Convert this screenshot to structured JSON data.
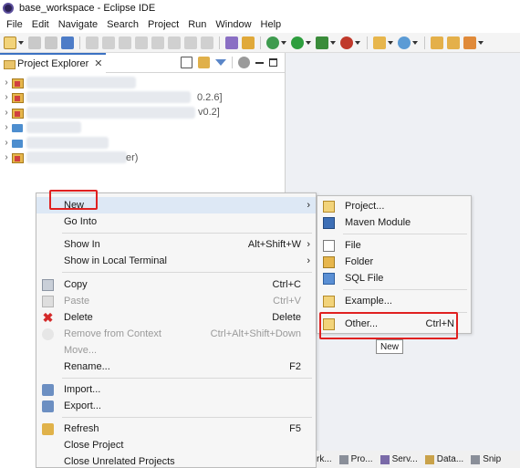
{
  "window": {
    "title": "base_workspace - Eclipse IDE"
  },
  "menubar": [
    "File",
    "Edit",
    "Navigate",
    "Search",
    "Project",
    "Run",
    "Window",
    "Help"
  ],
  "explorer": {
    "tab_label": "Project Explorer",
    "tab_close": "✕",
    "tree": [
      {
        "icon": "project-icon",
        "suffix": ""
      },
      {
        "icon": "project-icon",
        "suffix": "0.2.6]"
      },
      {
        "icon": "project-icon",
        "suffix": "v0.2]"
      },
      {
        "icon": "folder-icon",
        "suffix": ""
      },
      {
        "icon": "folder-icon",
        "suffix": ""
      },
      {
        "icon": "project-icon",
        "suffix": "er)"
      }
    ]
  },
  "context_menu": {
    "items": [
      {
        "label": "New",
        "shortcut": "",
        "arrow": "›",
        "icon": "",
        "enabled": true
      },
      {
        "label": "Go Into",
        "shortcut": "",
        "arrow": "",
        "icon": "",
        "enabled": true
      },
      {
        "label": "Show In",
        "shortcut": "Alt+Shift+W",
        "arrow": "›",
        "icon": "",
        "enabled": true
      },
      {
        "label": "Show in Local Terminal",
        "shortcut": "",
        "arrow": "›",
        "icon": "",
        "enabled": true
      },
      {
        "label": "Copy",
        "shortcut": "Ctrl+C",
        "arrow": "",
        "icon": "copy-icon",
        "enabled": true
      },
      {
        "label": "Paste",
        "shortcut": "Ctrl+V",
        "arrow": "",
        "icon": "paste-icon",
        "enabled": false
      },
      {
        "label": "Delete",
        "shortcut": "Delete",
        "arrow": "",
        "icon": "delete-icon",
        "enabled": true
      },
      {
        "label": "Remove from Context",
        "shortcut": "Ctrl+Alt+Shift+Down",
        "arrow": "",
        "icon": "remove-context-icon",
        "enabled": false
      },
      {
        "label": "Move...",
        "shortcut": "",
        "arrow": "",
        "icon": "",
        "enabled": false
      },
      {
        "label": "Rename...",
        "shortcut": "F2",
        "arrow": "",
        "icon": "",
        "enabled": true
      },
      {
        "label": "Import...",
        "shortcut": "",
        "arrow": "",
        "icon": "import-icon",
        "enabled": true
      },
      {
        "label": "Export...",
        "shortcut": "",
        "arrow": "",
        "icon": "export-icon",
        "enabled": true
      },
      {
        "label": "Refresh",
        "shortcut": "F5",
        "arrow": "",
        "icon": "refresh-icon",
        "enabled": true
      },
      {
        "label": "Close Project",
        "shortcut": "",
        "arrow": "",
        "icon": "",
        "enabled": true
      },
      {
        "label": "Close Unrelated Projects",
        "shortcut": "",
        "arrow": "",
        "icon": "",
        "enabled": true
      }
    ]
  },
  "sub_menu": {
    "items": [
      {
        "label": "Project...",
        "shortcut": "",
        "icon": "new-project-icon"
      },
      {
        "label": "Maven Module",
        "shortcut": "",
        "icon": "maven-module-icon"
      },
      {
        "label": "File",
        "shortcut": "",
        "icon": "file-icon"
      },
      {
        "label": "Folder",
        "shortcut": "",
        "icon": "folder-icon"
      },
      {
        "label": "SQL File",
        "shortcut": "",
        "icon": "sql-file-icon"
      },
      {
        "label": "Example...",
        "shortcut": "",
        "icon": "example-icon"
      },
      {
        "label": "Other...",
        "shortcut": "Ctrl+N",
        "icon": "other-wizard-icon"
      }
    ]
  },
  "tooltip": "New",
  "bottom_tabs": [
    {
      "label": "rk...",
      "icon": ""
    },
    {
      "label": "Pro...",
      "icon": "problems-icon"
    },
    {
      "label": "Serv...",
      "icon": "servers-icon"
    },
    {
      "label": "Data...",
      "icon": "data-source-icon"
    },
    {
      "label": "Snip",
      "icon": "snippets-icon"
    }
  ],
  "colors": {
    "highlight": "#dde8f5",
    "annotation_red": "#e02020",
    "active_tab_border": "#3b71c2"
  }
}
